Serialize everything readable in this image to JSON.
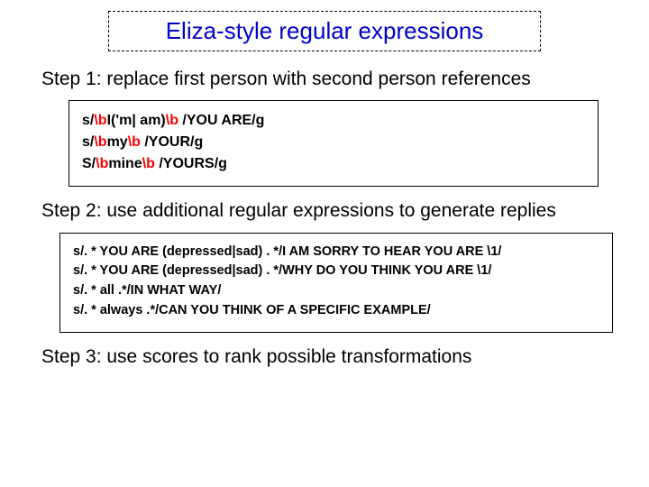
{
  "title": "Eliza-style regular expressions",
  "steps": {
    "s1": "Step 1: replace first person with second person references",
    "s2": "Step 2: use additional regular expressions to generate replies",
    "s3": "Step 3: use scores to rank possible transformations"
  },
  "block1": {
    "l1a": "s/",
    "l1b": "\\b",
    "l1c": "I('m| am)",
    "l1d": "\\b",
    "l1e": " /YOU ARE/g",
    "l2a": "s/",
    "l2b": "\\b",
    "l2c": "my",
    "l2d": "\\b",
    "l2e": " /YOUR/g",
    "l3a": "S/",
    "l3b": "\\b",
    "l3c": "mine",
    "l3d": "\\b",
    "l3e": " /YOURS/g"
  },
  "block2": {
    "l1": "s/. * YOU ARE (depressed|sad) . */I AM SORRY TO HEAR YOU ARE \\1/",
    "l2": "s/. * YOU ARE (depressed|sad) . */WHY DO YOU THINK YOU ARE \\1/",
    "l3": "s/. * all .*/IN WHAT WAY/",
    "l4": "s/. * always .*/CAN YOU THINK OF A SPECIFIC EXAMPLE/"
  }
}
